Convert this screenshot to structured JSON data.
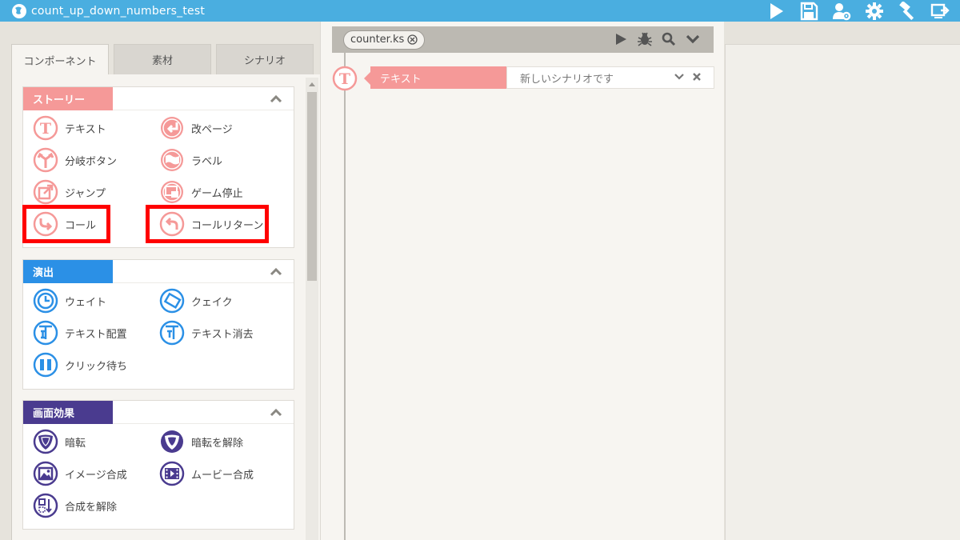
{
  "window": {
    "title": "count_up_down_numbers_test"
  },
  "toolbar": {
    "icons": [
      "play-icon",
      "save-icon",
      "user-settings-icon",
      "gear-icon",
      "hammer-icon",
      "export-icon"
    ]
  },
  "tabs": [
    {
      "label": "コンポーネント",
      "active": true
    },
    {
      "label": "素材",
      "active": false
    },
    {
      "label": "シナリオ",
      "active": false
    }
  ],
  "sections": [
    {
      "title": "ストーリー",
      "color": "#f59998",
      "items": [
        {
          "label": "テキスト",
          "icon": "text-t-icon"
        },
        {
          "label": "改ページ",
          "icon": "page-break-icon"
        },
        {
          "label": "分岐ボタン",
          "icon": "branch-icon"
        },
        {
          "label": "ラベル",
          "icon": "flag-icon"
        },
        {
          "label": "ジャンプ",
          "icon": "jump-icon"
        },
        {
          "label": "ゲーム停止",
          "icon": "game-stop-icon"
        },
        {
          "label": "コール",
          "icon": "call-icon"
        },
        {
          "label": "コールリターン",
          "icon": "call-return-icon"
        }
      ]
    },
    {
      "title": "演出",
      "color": "#2b90e6",
      "items": [
        {
          "label": "ウェイト",
          "icon": "clock-icon"
        },
        {
          "label": "クェイク",
          "icon": "quake-icon"
        },
        {
          "label": "テキスト配置",
          "icon": "text-place-icon"
        },
        {
          "label": "テキスト消去",
          "icon": "text-erase-icon"
        },
        {
          "label": "クリック待ち",
          "icon": "pause-icon"
        }
      ]
    },
    {
      "title": "画面効果",
      "color": "#4a3b8f",
      "items": [
        {
          "label": "暗転",
          "icon": "blackout-icon"
        },
        {
          "label": "暗転を解除",
          "icon": "blackout-release-icon"
        },
        {
          "label": "イメージ合成",
          "icon": "image-compose-icon"
        },
        {
          "label": "ムービー合成",
          "icon": "movie-compose-icon"
        },
        {
          "label": "合成を解除",
          "icon": "compose-release-icon"
        }
      ]
    }
  ],
  "editor": {
    "file_tab": "counter.ks",
    "rows": [
      {
        "label": "テキスト",
        "value": "新しいシナリオです"
      }
    ]
  },
  "colors": {
    "titlebar": "#4aaee0",
    "highlight": "#ff0000"
  }
}
